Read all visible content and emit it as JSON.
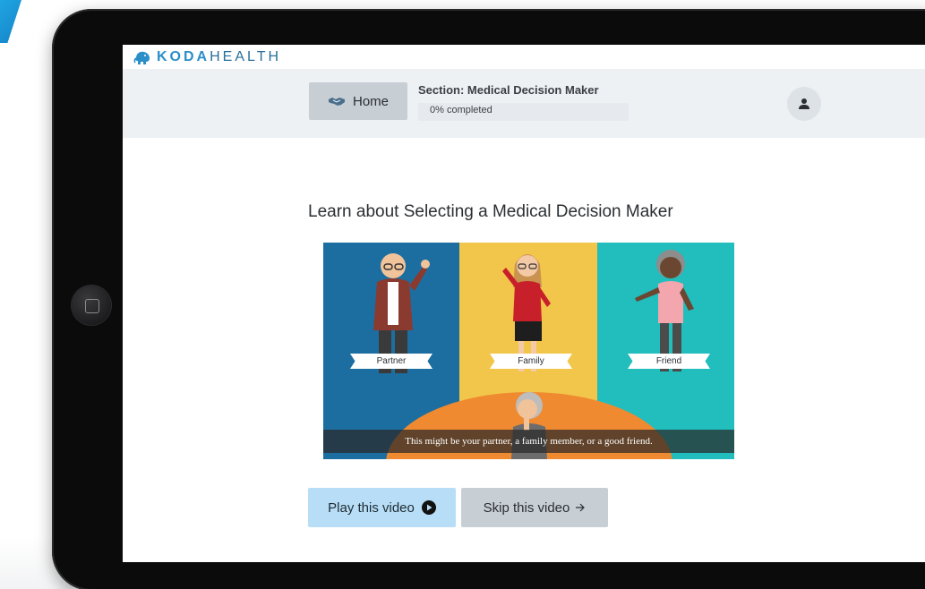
{
  "brand": {
    "name_part1": "KODA",
    "name_part2": "HEALTH",
    "accent_color": "#2a8fc9"
  },
  "header": {
    "home_label": "Home",
    "home_icon": "handshake-icon",
    "section_title": "Section: Medical Decision Maker",
    "progress_text": "0% completed",
    "progress_percent": 0,
    "user_icon": "user-icon"
  },
  "main": {
    "heading": "Learn about Selecting a Medical Decision Maker",
    "video": {
      "labels": [
        "Partner",
        "Family",
        "Friend"
      ],
      "caption": "This might be your partner, a family member, or a good friend.",
      "panel_colors": [
        "#1d6ea0",
        "#f1c64a",
        "#22bdbd"
      ]
    },
    "play_label": "Play this video",
    "play_icon": "play-circle-icon",
    "skip_label": "Skip this video",
    "skip_icon": "arrow-right-icon"
  }
}
